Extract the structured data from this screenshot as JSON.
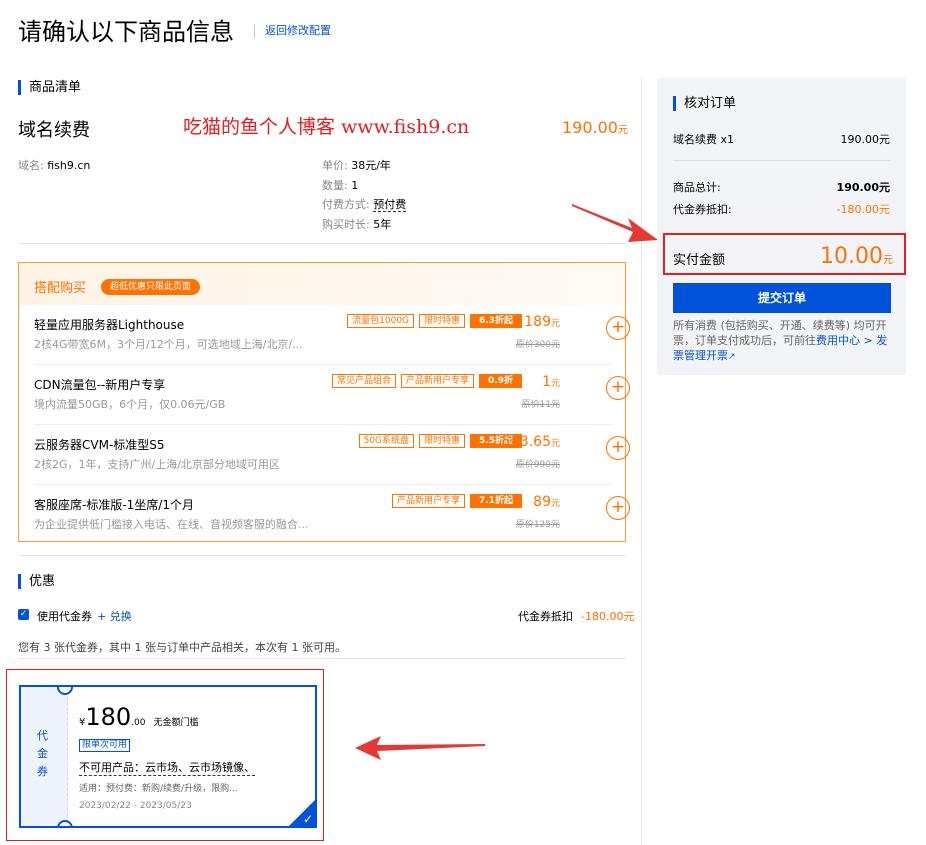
{
  "page": {
    "title": "请确认以下商品信息",
    "back_link": "返回修改配置"
  },
  "goods": {
    "section_title": "商品清单",
    "name": "域名续费",
    "watermark": "吃猫的鱼个人博客 www.fish9.cn",
    "price": "190.00",
    "price_unit": "元",
    "domain_label": "域名:",
    "domain_value": "fish9.cn",
    "unit_price_label": "单价:",
    "unit_price_value": "38元/年",
    "qty_label": "数量:",
    "qty_value": "1",
    "pay_method_label": "付费方式:",
    "pay_method_value": "预付费",
    "duration_label": "购买时长:",
    "duration_value": "5年"
  },
  "bundle": {
    "title": "搭配购买",
    "badge": "超低优惠只限此页面",
    "items": [
      {
        "name": "轻量应用服务器Lighthouse",
        "desc": "2核4G带宽6M，3个月/12个月，可选地域上海/北京/...",
        "tags": [
          "流量包1000G",
          "限时特惠"
        ],
        "discount": "6.3折起",
        "price": "189",
        "unit": "元",
        "orig": "原价300元"
      },
      {
        "name": "CDN流量包--新用户专享",
        "desc": "境内流量50GB，6个月，仅0.06元/GB",
        "tags": [
          "常见产品组合",
          "产品新用户专享"
        ],
        "discount": "0.9折",
        "price": "1",
        "unit": "元",
        "orig": "原价11元"
      },
      {
        "name": "云服务器CVM-标准型S5",
        "desc": "2核2G，1年，支持广州/上海/北京部分地域可用区",
        "tags": [
          "50G系统盘",
          "限时特惠"
        ],
        "discount": "5.5折起",
        "price": "543.65",
        "unit": "元",
        "orig": "原价990元"
      },
      {
        "name": "客服座席-标准版-1坐席/1个月",
        "desc": "为企业提供低门槛接入电话、在线、音视频客服的融合...",
        "tags": [
          "产品新用户专享"
        ],
        "discount": "7.1折起",
        "price": "89",
        "unit": "元",
        "orig": "原价125元"
      }
    ]
  },
  "discount": {
    "section_title": "优惠",
    "use_coupon": "使用代金券",
    "exchange": "+ 兑换",
    "offset_label": "代金券抵扣",
    "offset_value": "-180.00元",
    "info": "您有 3 张代金券，其中 1 张与订单中产品相关，本次有 1 张可用。"
  },
  "coupon": {
    "side": "代金券",
    "currency": "¥",
    "amount": "180",
    "decimal": ".00",
    "threshold": "无金额门槛",
    "once_tag": "限单次可用",
    "unavailable": "不可用产品：云市场、云市场镜像、",
    "applicable": "适用：预付费：新购/续费/升级，限购...",
    "period": "2023/02/22 - 2023/05/23"
  },
  "order": {
    "title": "核对订单",
    "line_label": "域名续费 x1",
    "line_value": "190.00元",
    "total_label": "商品总计:",
    "total_value": "190.00元",
    "coupon_label": "代金券抵扣:",
    "coupon_value": "-180.00元",
    "pay_label": "实付金额",
    "pay_value": "10.00",
    "pay_unit": "元",
    "submit": "提交订单",
    "note_1": "所有消费 (包括购买、开通、续费等) 均可开票，订单支付成功后，可前往",
    "note_link_1": "费用中心 > 发票管理开票",
    "note_icon": "↗"
  }
}
